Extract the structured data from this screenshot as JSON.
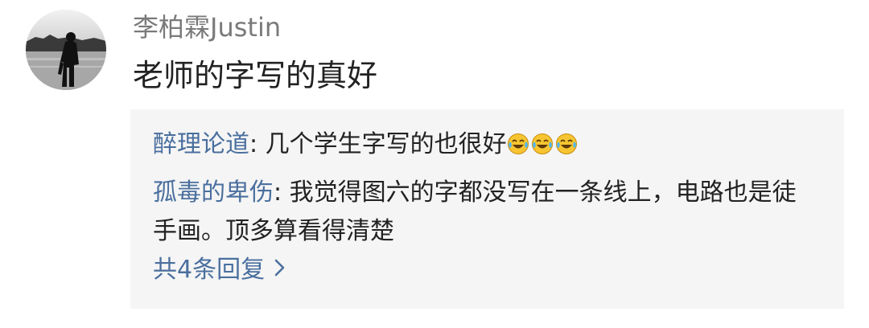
{
  "comment": {
    "author": "李柏霖Justin",
    "text": "老师的字写的真好",
    "avatar_icon": "person-silhouette-by-water-avatar"
  },
  "replies": [
    {
      "author": "醉理论道",
      "separator": ": ",
      "text": "几个学生字写的也很好",
      "emojis": [
        "laughing-crying-emoji",
        "laughing-crying-emoji",
        "laughing-crying-emoji"
      ]
    },
    {
      "author": "孤毒的卑伤",
      "separator": ": ",
      "text": "我觉得图六的字都没写在一条线上，电路也是徒手画。顶多算看得清楚"
    }
  ],
  "more_replies": {
    "label": "共4条回复",
    "icon": "chevron-right-icon"
  },
  "colors": {
    "link": "#4a6f9e",
    "username": "#7a7a7a",
    "text": "#222222",
    "reply_bg": "#f5f5f5"
  }
}
